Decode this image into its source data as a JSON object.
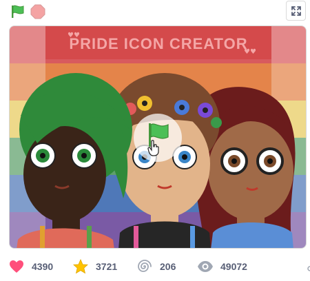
{
  "toolbar": {
    "green_flag_icon": "green-flag-icon",
    "stop_icon": "stop-sign-icon",
    "fullscreen_icon": "fullscreen-icon"
  },
  "stage": {
    "banner_text": "PRIDE ICON CREATOR",
    "play_icon": "green-flag-icon",
    "cursor_icon": "hand-pointer-icon"
  },
  "stats": {
    "loves": "4390",
    "favorites": "3721",
    "remixes": "206",
    "views": "49072"
  },
  "colors": {
    "love": "#ff4f7b",
    "favorite": "#ffc300",
    "icon_gray": "#a0a7b3",
    "stat_text": "#575e75",
    "flag_green": "#4cbf56",
    "stop_red": "#ec5959"
  }
}
